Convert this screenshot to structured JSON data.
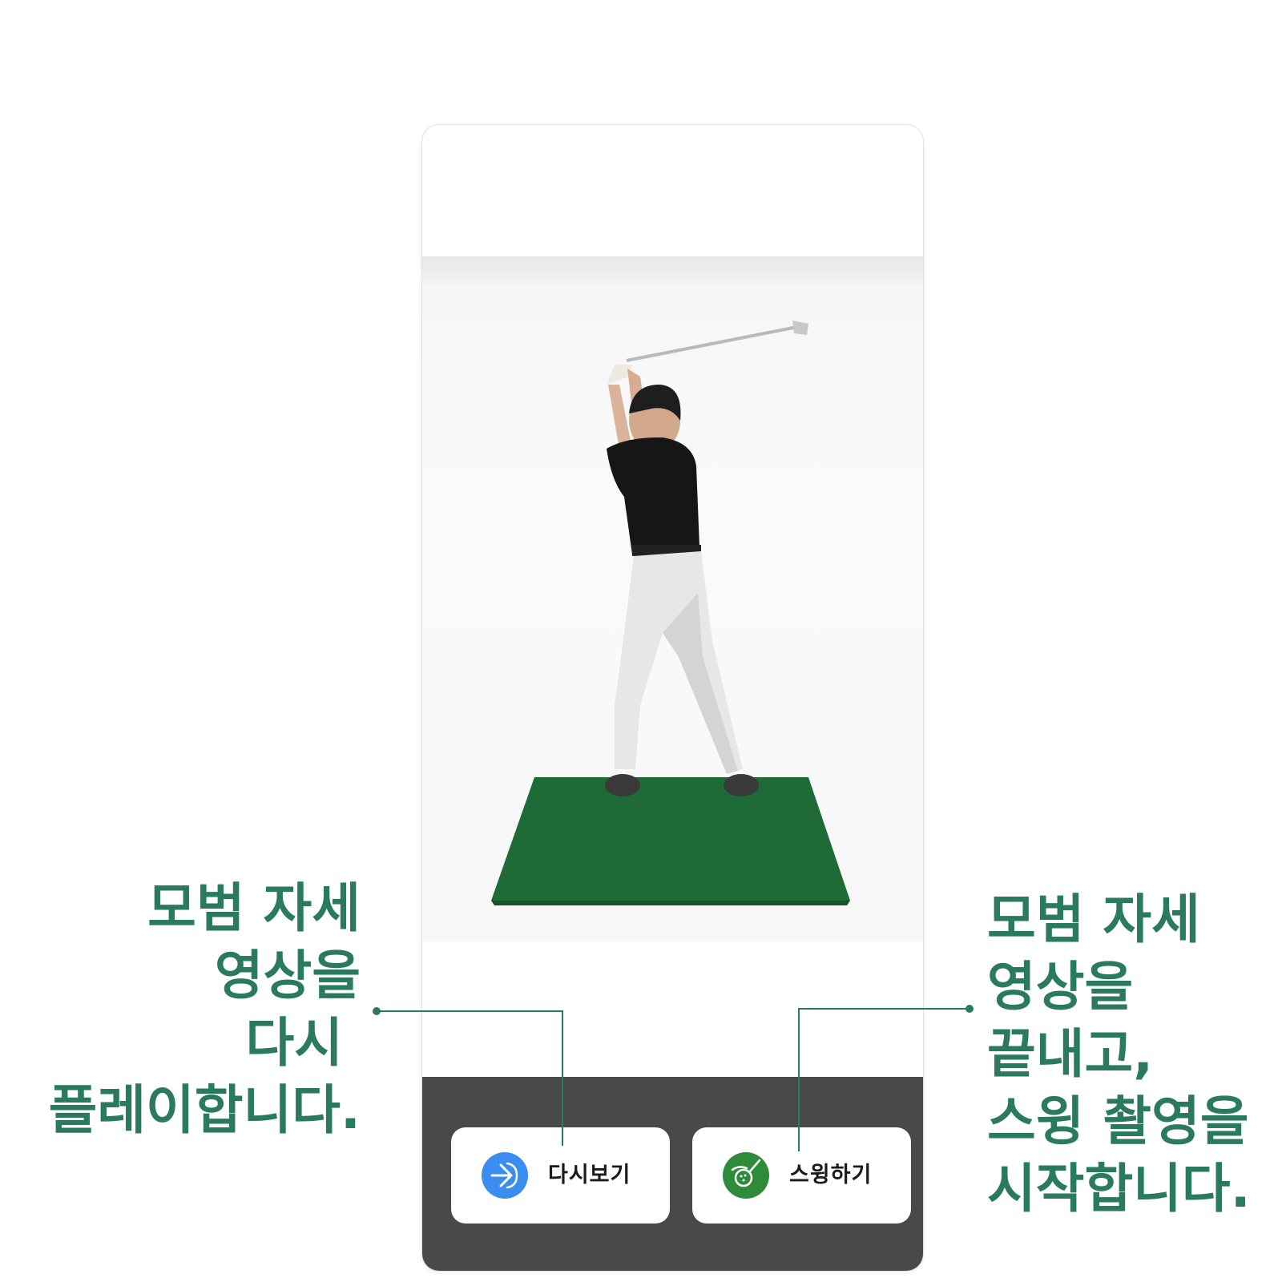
{
  "annotations": {
    "left": {
      "lines": [
        "모범 자세",
        "영상을",
        "다시",
        "플레이합니다."
      ]
    },
    "right": {
      "lines": [
        "모범 자세",
        "영상을",
        "끝내고,",
        "스윙 촬영을",
        "시작합니다."
      ]
    },
    "color": "#2a7a5d"
  },
  "video": {
    "subject": "golfer-backswing"
  },
  "bottom_bar": {
    "background": "#494949",
    "buttons": [
      {
        "label": "다시보기",
        "icon": "replay-arrow-icon",
        "icon_color": "#3b8df0"
      },
      {
        "label": "스윙하기",
        "icon": "golf-club-ball-icon",
        "icon_color": "#2e8b3a"
      }
    ]
  }
}
